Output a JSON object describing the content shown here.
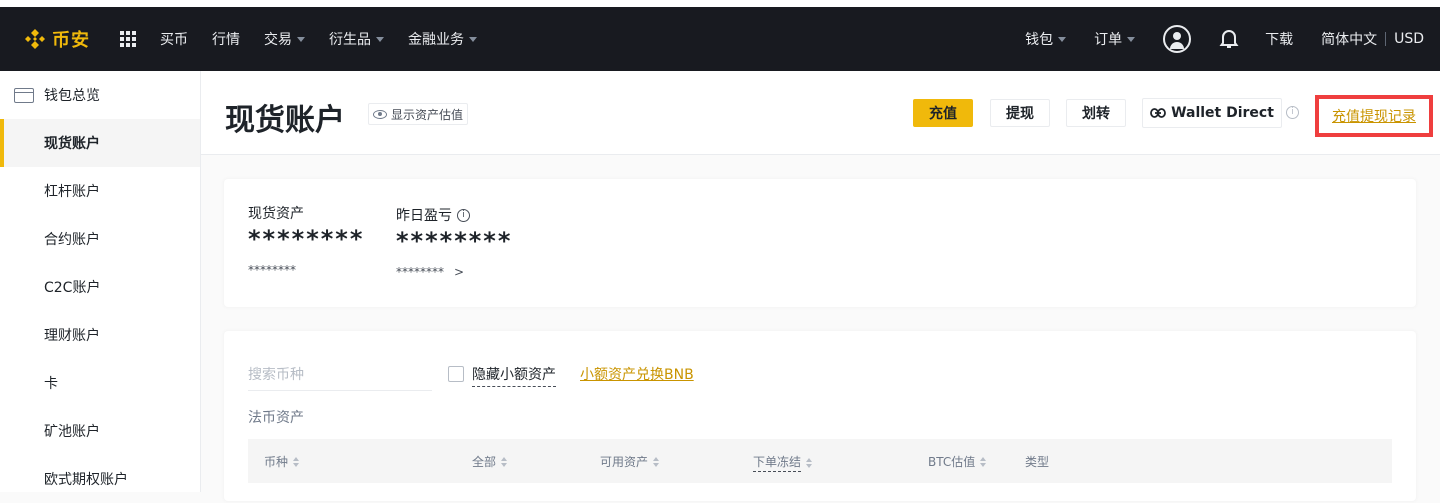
{
  "navbar": {
    "logo_text": "币安",
    "items": [
      {
        "label": "买币",
        "has_caret": false
      },
      {
        "label": "行情",
        "has_caret": false
      },
      {
        "label": "交易",
        "has_caret": true
      },
      {
        "label": "衍生品",
        "has_caret": true
      },
      {
        "label": "金融业务",
        "has_caret": true
      }
    ],
    "right": {
      "wallet": "钱包",
      "orders": "订单",
      "download": "下载",
      "language": "简体中文",
      "currency": "USD"
    },
    "colors": {
      "background": "#181a20",
      "brand": "#f0b90b"
    }
  },
  "sidebar": {
    "items": [
      {
        "label": "钱包总览",
        "icon": "wallet-icon"
      },
      {
        "label": "现货账户",
        "active": true
      },
      {
        "label": "杠杆账户"
      },
      {
        "label": "合约账户"
      },
      {
        "label": "C2C账户"
      },
      {
        "label": "理财账户"
      },
      {
        "label": "卡"
      },
      {
        "label": "矿池账户"
      },
      {
        "label": "欧式期权账户"
      }
    ]
  },
  "header": {
    "title": "现货账户",
    "show_estimate": "显示资产估值",
    "buttons": {
      "deposit": "充值",
      "withdraw": "提现",
      "transfer": "划转",
      "wallet_direct": "Wallet Direct"
    },
    "records_link": "充值提现记录"
  },
  "summary": {
    "spot_assets_label": "现货资产",
    "spot_assets_value": "********",
    "spot_assets_sub": "********",
    "pnl_label": "昨日盈亏",
    "pnl_value": "********",
    "pnl_sub": "********",
    "pnl_arrow": ">"
  },
  "assets": {
    "search_placeholder": "搜索币种",
    "hide_small": "隐藏小额资产",
    "convert_link": "小额资产兑换BNB",
    "fiat_label": "法币资产",
    "columns": {
      "coin": "币种",
      "total": "全部",
      "available": "可用资产",
      "in_order": "下单冻结",
      "btc_value": "BTC估值",
      "type": "类型"
    }
  }
}
